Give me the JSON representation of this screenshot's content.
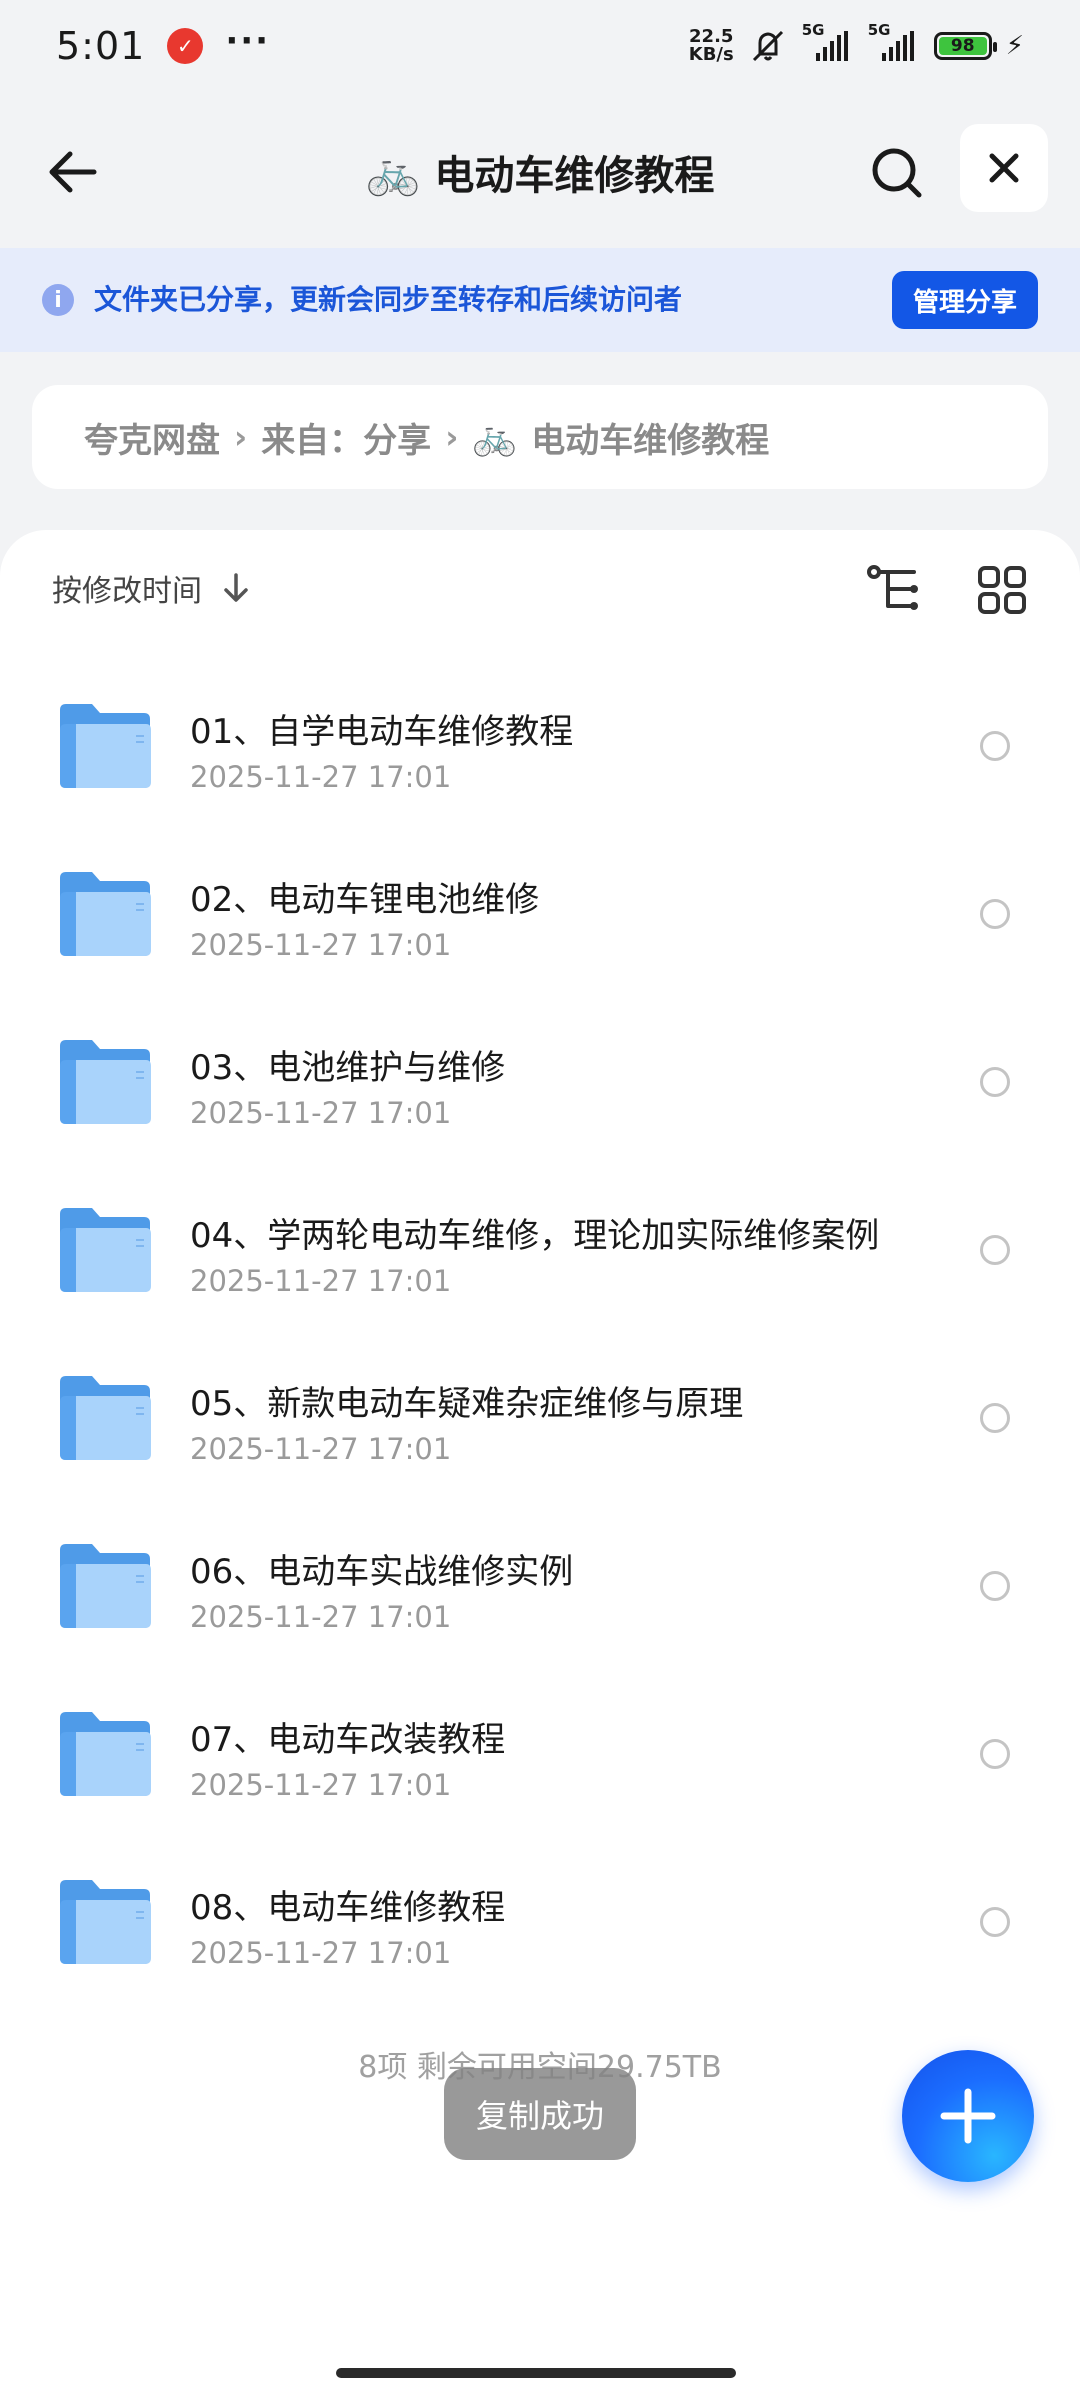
{
  "status_bar": {
    "time": "5:01",
    "more": "···",
    "speed_value": "22.5",
    "speed_unit": "KB/s",
    "network_1": "5G",
    "network_2": "5G",
    "battery_level": "98",
    "icons": [
      "app-notification-icon",
      "mute-icon",
      "signal-icon",
      "battery-icon",
      "charging-icon"
    ]
  },
  "header": {
    "title_emoji": "🚲",
    "title": "电动车维修教程",
    "icons": [
      "back-arrow-icon",
      "search-icon",
      "close-icon"
    ]
  },
  "share_banner": {
    "info_glyph": "i",
    "message": "文件夹已分享，更新会同步至转存和后续访问者",
    "manage_label": "管理分享",
    "accent": "#1357e6"
  },
  "breadcrumb": {
    "items": [
      "夸克网盘",
      "来自：分享",
      "电动车维修教程"
    ],
    "separator": "›",
    "emoji": "🚲"
  },
  "sort": {
    "label": "按修改时间"
  },
  "files": [
    {
      "name": "01、自学电动车维修教程",
      "date": "2025-11-27 17:01"
    },
    {
      "name": "02、电动车锂电池维修",
      "date": "2025-11-27 17:01"
    },
    {
      "name": "03、电池维护与维修",
      "date": "2025-11-27 17:01"
    },
    {
      "name": "04、学两轮电动车维修，理论加实际维修案例",
      "date": "2025-11-27 17:01"
    },
    {
      "name": "05、新款电动车疑难杂症维修与原理",
      "date": "2025-11-27 17:01"
    },
    {
      "name": "06、电动车实战维修实例",
      "date": "2025-11-27 17:01"
    },
    {
      "name": "07、电动车改装教程",
      "date": "2025-11-27 17:01"
    },
    {
      "name": "08、电动车维修教程",
      "date": "2025-11-27 17:01"
    }
  ],
  "footer": {
    "summary": "8项  剩余可用空间29.75TB"
  },
  "toast": {
    "text": "复制成功"
  },
  "colors": {
    "folder": "#5aa4ef",
    "fab": "#1b6dff"
  }
}
